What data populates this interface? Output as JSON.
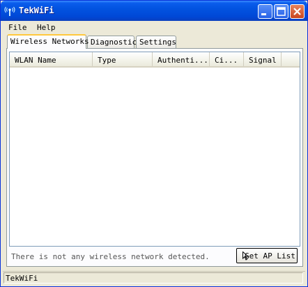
{
  "window": {
    "title": "TekWiFi"
  },
  "menu": {
    "file": "File",
    "help": "Help"
  },
  "tabs": [
    {
      "label": "Wireless Networks",
      "active": true
    },
    {
      "label": "Diagnostic",
      "active": false
    },
    {
      "label": "Settings",
      "active": false
    }
  ],
  "table": {
    "columns": [
      "WLAN Name",
      "Type",
      "Authenti...",
      "Ci...",
      "Signal"
    ],
    "rows": []
  },
  "status_message": "There is not any wireless network detected.",
  "buttons": {
    "get_ap_list": "Get AP List"
  },
  "statusbar": {
    "text": "TekWiFi"
  },
  "icons": {
    "app": "wifi-antenna-icon",
    "minimize": "minimize-icon",
    "maximize": "maximize-icon",
    "close": "close-icon"
  }
}
